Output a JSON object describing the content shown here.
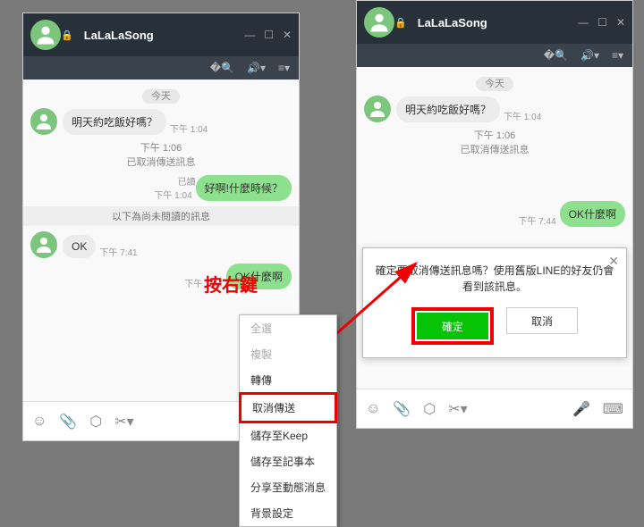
{
  "contact": {
    "name": "LaLaLaSong"
  },
  "date_label": "今天",
  "messages": {
    "m1": {
      "text": "明天約吃飯好嗎？",
      "time": "下午 1:04"
    },
    "unsent": {
      "time": "下午 1:06",
      "label": "已取消傳送訊息"
    },
    "m2": {
      "text": "好啊!什麼時候？",
      "time": "下午 1:04",
      "read": "已讀"
    },
    "unread_sep": "以下為尚未閱讀的訊息",
    "m3": {
      "text": "OK",
      "time": "下午 7:41"
    },
    "m4": {
      "text": "OK什麼啊",
      "time": "下午 7:44"
    },
    "m4b": {
      "text": "OK什麼啊",
      "time": "下午 7:44"
    }
  },
  "annotation": "按右鍵",
  "context_menu": {
    "select_all": "全選",
    "copy": "複製",
    "forward": "轉傳",
    "unsend": "取消傳送",
    "save_keep": "儲存至Keep",
    "save_note": "儲存至記事本",
    "share_timeline": "分享至動態消息",
    "bg_settings": "背景設定"
  },
  "dialog": {
    "message": "確定要取消傳送訊息嗎？使用舊版LINE的好友仍會看到該訊息。",
    "ok": "確定",
    "cancel": "取消"
  }
}
